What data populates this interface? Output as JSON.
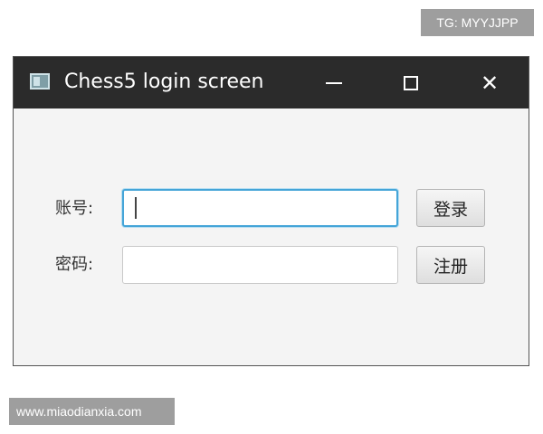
{
  "watermarks": {
    "top": "TG: MYYJJPP",
    "bottom": "www.miaodianxia.com"
  },
  "window": {
    "title": "Chess5 login screen",
    "icon": "app-window-icon",
    "controls": {
      "minimize_icon": "minimize-icon",
      "maximize_icon": "maximize-icon",
      "close_glyph": "✕"
    }
  },
  "form": {
    "account_label": "账号:",
    "account_value": "",
    "password_label": "密码:",
    "password_value": "",
    "login_button": "登录",
    "register_button": "注册"
  },
  "colors": {
    "titlebar": "#2b2b2b",
    "window_bg": "#f4f4f4",
    "focus_border": "#45a5d8"
  }
}
